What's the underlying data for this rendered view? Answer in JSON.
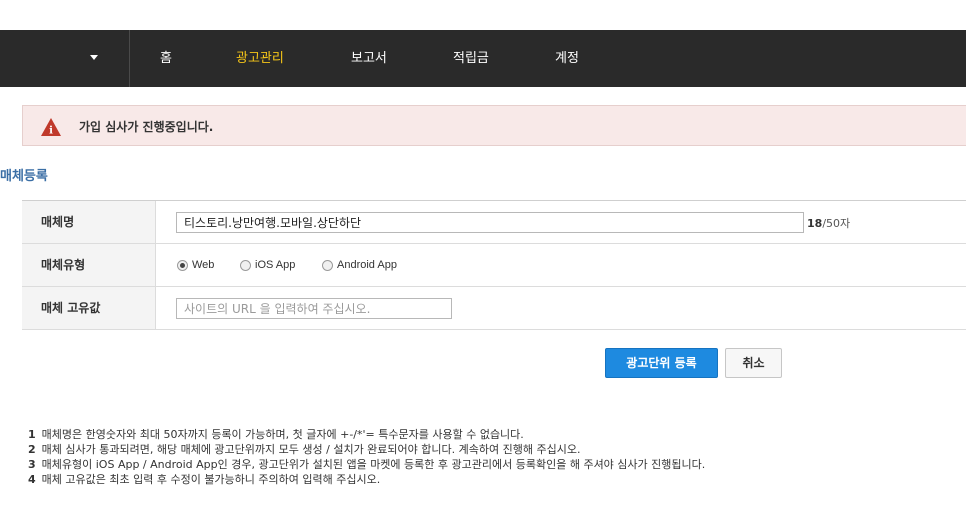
{
  "nav": {
    "items": [
      {
        "label": "홈",
        "active": false
      },
      {
        "label": "광고관리",
        "active": true
      },
      {
        "label": "보고서",
        "active": false
      },
      {
        "label": "적립금",
        "active": false
      },
      {
        "label": "계정",
        "active": false
      }
    ],
    "active_color": "#f5c518",
    "background": "#2a2a2a"
  },
  "alert": {
    "icon": "warning-icon",
    "icon_glyph": "i",
    "message": "가입 심사가 진행중입니다.",
    "icon_color": "#c0392b"
  },
  "section_title": "매체등록",
  "form": {
    "name": {
      "label": "매체명",
      "value": "티스토리.낭만여행.모바일.상단하단",
      "count_current": "18",
      "count_suffix": "/50자"
    },
    "type": {
      "label": "매체유형",
      "options": [
        {
          "label": "Web",
          "selected": true
        },
        {
          "label": "iOS App",
          "selected": false
        },
        {
          "label": "Android App",
          "selected": false
        }
      ]
    },
    "unique": {
      "label": "매체 고유값",
      "value": "",
      "placeholder": "사이트의 URL 을 입력하여 주십시오."
    }
  },
  "buttons": {
    "register": "광고단위 등록",
    "cancel": "취소",
    "primary_color": "#1e8ae0"
  },
  "notes": [
    {
      "num": "1",
      "text": "매체명은 한영숫자와 최대 50자까지 등록이 가능하며, 첫 글자에 +-/*'= 특수문자를 사용할 수 없습니다."
    },
    {
      "num": "2",
      "text": "매체 심사가 통과되려면, 해당 매체에 광고단위까지 모두 생성 / 설치가 완료되어야 합니다. 계속하여 진행해 주십시오."
    },
    {
      "num": "3",
      "text": "매체유형이 iOS App / Android App인 경우, 광고단위가 설치된 앱을 마켓에 등록한 후 광고관리에서 등록확인을 해 주셔야 심사가 진행됩니다."
    },
    {
      "num": "4",
      "text": "매체 고유값은 최초 입력 후 수정이 불가능하니 주의하여 입력해 주십시오."
    }
  ]
}
